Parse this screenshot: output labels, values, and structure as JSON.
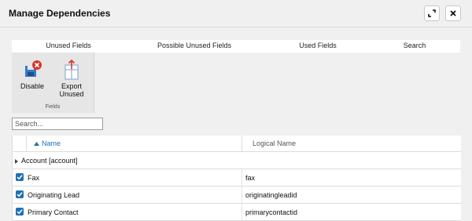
{
  "dialog": {
    "title": "Manage Dependencies"
  },
  "tabs": [
    {
      "label": "Unused Fields"
    },
    {
      "label": "Possible Unused Fields"
    },
    {
      "label": "Used Fields"
    },
    {
      "label": "Search"
    }
  ],
  "ribbon": {
    "disable_label": "Disable",
    "export_label_line1": "Export",
    "export_label_line2": "Unused",
    "group_label": "Fields"
  },
  "search": {
    "placeholder": "Search..."
  },
  "grid": {
    "columns": {
      "name": "Name",
      "logical": "Logical Name"
    },
    "group": "Account [account]",
    "rows": [
      {
        "name": "Fax",
        "logical": "fax",
        "checked": true
      },
      {
        "name": "Originating Lead",
        "logical": "originatingleadid",
        "checked": true
      },
      {
        "name": "Primary Contact",
        "logical": "primarycontactid",
        "checked": true
      }
    ]
  },
  "colors": {
    "accent": "#1f6fb5",
    "danger": "#d9342b"
  }
}
